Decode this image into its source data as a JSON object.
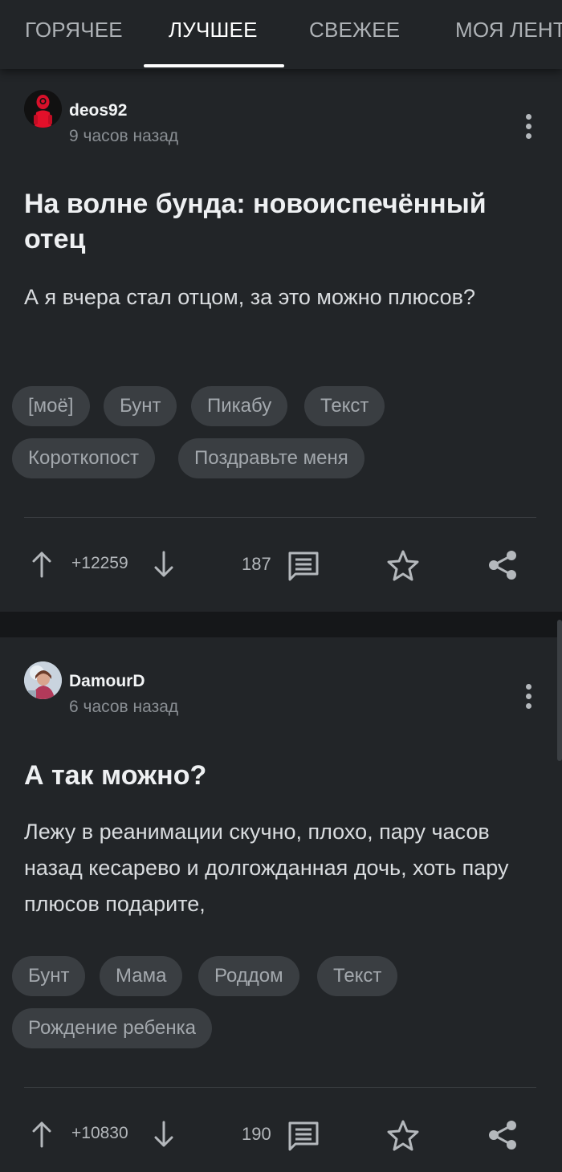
{
  "tabs": [
    {
      "label": "ГОРЯЧЕЕ",
      "active": false
    },
    {
      "label": "ЛУЧШЕЕ",
      "active": true
    },
    {
      "label": "СВЕЖЕЕ",
      "active": false
    },
    {
      "label": "МОЯ ЛЕНТА",
      "active": false
    }
  ],
  "posts": [
    {
      "author": "deos92",
      "time": "9 часов назад",
      "title": "На волне бунда: новоиспечённый отец",
      "text": "А я вчера стал отцом, за это можно плюсов?",
      "tags": [
        "[моё]",
        "Бунт",
        "Пикабу",
        "Текст",
        "Короткопост",
        "Поздравьте меня"
      ],
      "rating": "+12259",
      "comments": "187"
    },
    {
      "author": "DamourD",
      "time": "6 часов назад",
      "title": "А так можно?",
      "text": "Лежу в реанимации скучно, плохо, пару часов назад кесарево и долгожданная дочь, хоть пару плюсов подарите,",
      "tags": [
        "Бунт",
        "Мама",
        "Роддом",
        "Текст",
        "Рождение ребенка"
      ],
      "rating": "+10830",
      "comments": "190"
    }
  ],
  "colors": {
    "background": "#151719",
    "card": "#222528",
    "tag_bg": "#3a3e42",
    "text_primary": "#eef0f2",
    "text_muted": "#8a8f94",
    "accent_red": "#e3102a"
  },
  "icons": {
    "upvote": "arrow-up-icon",
    "downvote": "arrow-down-icon",
    "comments": "comment-icon",
    "save": "star-icon",
    "share": "share-icon",
    "menu": "more-vertical-icon"
  }
}
